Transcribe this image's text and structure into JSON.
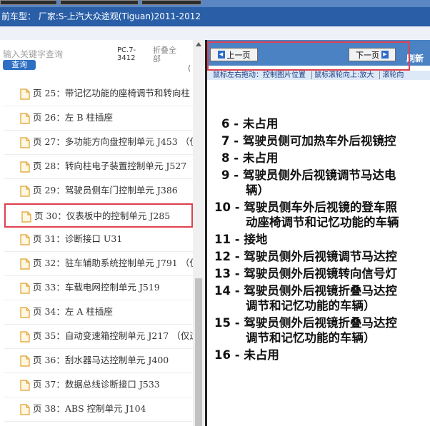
{
  "header": {
    "vehicle_model_label": "前车型：  厂家:S-上汽大众途观(Tiguan)2011-2012"
  },
  "sidebar": {
    "search_placeholder": "输入关键字查询",
    "search_button": "查询",
    "pc_label": "PC.7-\n3412",
    "fold_label": "折叠全\n部",
    "clipped_char": "(",
    "items": [
      {
        "label": "页 25：带记忆功能的座椅调节和转向柱"
      },
      {
        "label": "页 26：左 B 柱插座"
      },
      {
        "label": "页 27：多功能方向盘控制单元 J453 （仅"
      },
      {
        "label": "页 28：转向柱电子装置控制单元 J527"
      },
      {
        "label": "页 29：驾驶员侧车门控制单元 J386"
      },
      {
        "label": "页 30：仪表板中的控制单元 J285"
      },
      {
        "label": "页 31：诊断接口 U31"
      },
      {
        "label": "页 32：驻车辅助系统控制单元 J791 （仅"
      },
      {
        "label": "页 33：车载电网控制单元 J519"
      },
      {
        "label": "页 34：左 A 柱插座"
      },
      {
        "label": "页 35：自动变速箱控制单元 J217 （仅过"
      },
      {
        "label": "页 36：刮水器马达控制单元 J400"
      },
      {
        "label": "页 37：数据总线诊断接口 J533"
      },
      {
        "label": "页 38：ABS 控制单元 J104"
      }
    ],
    "selected_index": 5
  },
  "viewer": {
    "prev_label": "上一页",
    "next_label": "下一页",
    "refresh_label": "刷新",
    "hint_left": "鼠标左右拖动：控制图片位置",
    "hint_mid": "鼠标滚轮向上:放大",
    "hint_right": "滚轮向",
    "entries": [
      {
        "num": "6 -",
        "text": "未占用"
      },
      {
        "num": "7 -",
        "text": "驾驶员侧可加热车外后视镜控"
      },
      {
        "num": "8 -",
        "text": "未占用"
      },
      {
        "num": "9 -",
        "text": "驾驶员侧外后视镜调节马达电",
        "cont": "辆）"
      },
      {
        "num": "10 -",
        "text": "驾驶员侧车外后视镜的登车照",
        "cont": "动座椅调节和记忆功能的车辆"
      },
      {
        "num": "11 -",
        "text": "接地"
      },
      {
        "num": "12 -",
        "text": "驾驶员侧外后视镜调节马达控"
      },
      {
        "num": "13 -",
        "text": "驾驶员侧外后视镜转向信号灯"
      },
      {
        "num": "14 -",
        "text": "驾驶员侧外后视镜折叠马达控",
        "cont": "调节和记忆功能的车辆）"
      },
      {
        "num": "15 -",
        "text": "驾驶员侧外后视镜折叠马达控",
        "cont": "调节和记忆功能的车辆）"
      },
      {
        "num": "16 -",
        "text": "未占用"
      }
    ]
  },
  "colors": {
    "header_blue": "#2a5fa8",
    "nav_blue": "#4a82c4",
    "highlight_red": "#e04050",
    "search_button_blue": "#2e6fc4"
  }
}
